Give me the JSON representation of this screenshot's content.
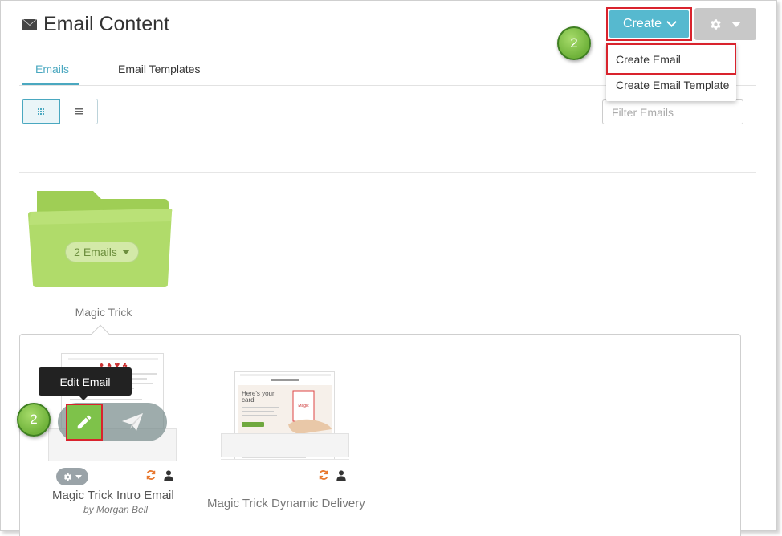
{
  "header": {
    "title": "Email Content",
    "create_label": "Create",
    "step_number": "2"
  },
  "tabs": [
    {
      "label": "Emails",
      "active": true
    },
    {
      "label": "Email Templates",
      "active": false
    }
  ],
  "toolbar": {
    "filter_placeholder": "Filter Emails"
  },
  "create_menu": {
    "items": [
      {
        "label": "Create Email"
      },
      {
        "label": "Create Email Template"
      }
    ]
  },
  "folder": {
    "name": "Magic Trick",
    "count_label": "2 Emails"
  },
  "emails": [
    {
      "name": "Magic Trick Intro Email",
      "author": "by Morgan Bell"
    },
    {
      "name": "Magic Trick Dynamic Delivery"
    }
  ],
  "hover_actions": {
    "tooltip": "Edit Email",
    "step_number": "2"
  },
  "thumb2": {
    "headline_1": "Here's your",
    "headline_2": "card",
    "card_text": "Magic"
  },
  "colors": {
    "accent": "#4aa8c0",
    "create_button": "#56b9cf",
    "highlight": "#d9232d",
    "folder_green": "#a8d45c",
    "badge_green": "#7ec24a",
    "sync_orange": "#e8782f"
  },
  "icons": {
    "title": "envelope-icon",
    "settings": "gear-icon",
    "edit": "pencil-icon",
    "send": "paper-plane-icon",
    "sync": "sync-icon",
    "owner": "user-icon"
  }
}
